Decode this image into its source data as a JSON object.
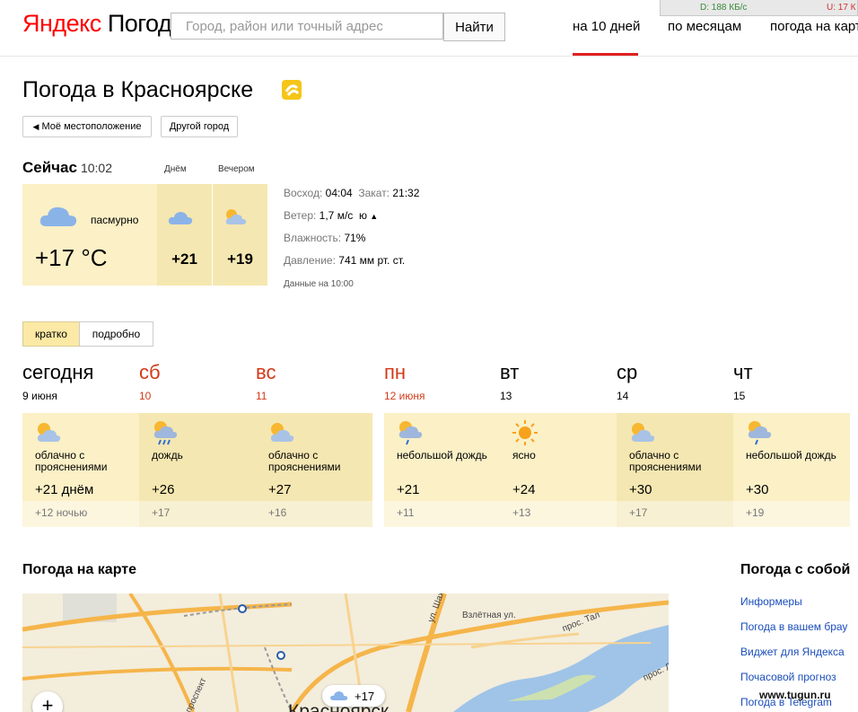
{
  "header": {
    "logo_part1": "Яндекс",
    "logo_part2": "Погода",
    "search_placeholder": "Город, район или точный адрес",
    "search_button": "Найти",
    "nav": [
      "на 10 дней",
      "по месяцам",
      "погода на карт"
    ],
    "net_down": "D: 188 КБ/с",
    "net_up": "U: 17 К"
  },
  "page": {
    "title": "Погода в Красноярске",
    "my_location": "Моё местоположение",
    "other_city": "Другой город"
  },
  "now": {
    "label": "Сейчас",
    "time": "10:02",
    "day_label": "Днём",
    "evening_label": "Вечером",
    "condition": "пасмурно",
    "temp": "+17 °C",
    "day_temp": "+21",
    "evening_temp": "+19",
    "sunrise_label": "Восход:",
    "sunrise": "04:04",
    "sunset_label": "Закат:",
    "sunset": "21:32",
    "wind_label": "Ветер:",
    "wind": "1,7 м/с",
    "wind_dir": "ю",
    "humidity_label": "Влажность:",
    "humidity": "71%",
    "pressure_label": "Давление:",
    "pressure": "741 мм рт. ст.",
    "updated": "Данные на 10:00"
  },
  "tabs": {
    "brief": "кратко",
    "detailed": "подробно"
  },
  "forecast": [
    {
      "day": "сегодня",
      "date": "9 июня",
      "cond": "облачно с прояснениями",
      "tday": "+21 днём",
      "tnight": "+12 ночью",
      "weekend": false,
      "icon": "partly-cloudy-icon"
    },
    {
      "day": "сб",
      "date": "10",
      "cond": "дождь",
      "tday": "+26",
      "tnight": "+17",
      "weekend": true,
      "icon": "rain-icon"
    },
    {
      "day": "вс",
      "date": "11",
      "cond": "облачно с прояснениями",
      "tday": "+27",
      "tnight": "+16",
      "weekend": true,
      "icon": "partly-cloudy-icon"
    },
    {
      "day": "пн",
      "date": "12 июня",
      "cond": "небольшой дождь",
      "tday": "+21",
      "tnight": "+11",
      "weekend": true,
      "icon": "light-rain-icon"
    },
    {
      "day": "вт",
      "date": "13",
      "cond": "ясно",
      "tday": "+24",
      "tnight": "+13",
      "weekend": false,
      "icon": "sun-icon"
    },
    {
      "day": "ср",
      "date": "14",
      "cond": "облачно с прояснениями",
      "tday": "+30",
      "tnight": "+17",
      "weekend": false,
      "icon": "partly-cloudy-icon"
    },
    {
      "day": "чт",
      "date": "15",
      "cond": "небольшой дождь",
      "tday": "+30",
      "tnight": "+19",
      "weekend": false,
      "icon": "light-rain-icon"
    }
  ],
  "map": {
    "title": "Погода на карте",
    "zoom_in": "+",
    "marker_temp": "+17",
    "city_label": "Красноярск",
    "street1": "Взлётная ул.",
    "street2": "ул. Шахтёров",
    "street3": "проспект",
    "street4": "прос. Тал",
    "street5": "прос. Ле"
  },
  "with_you": {
    "title": "Погода с собой",
    "links": [
      "Информеры",
      "Погода в вашем брау",
      "Виджет для Яндекса",
      "Почасовой прогноз",
      "Погода в Telegram"
    ]
  },
  "watermark": "www.tugun.ru"
}
